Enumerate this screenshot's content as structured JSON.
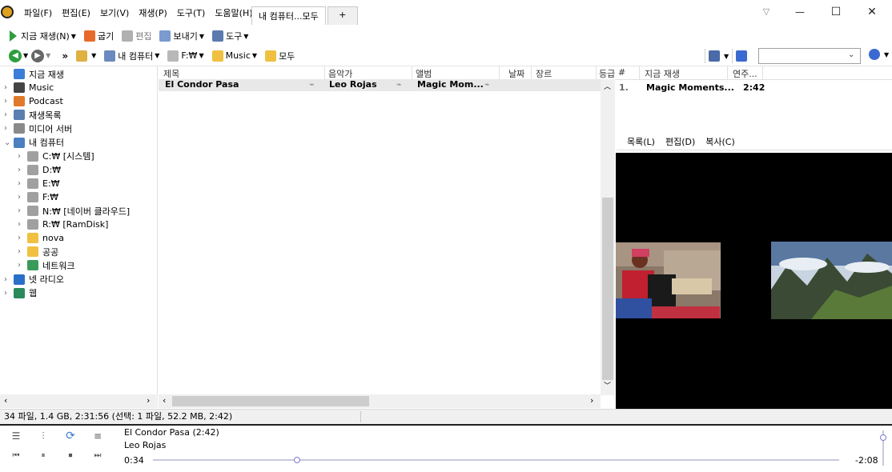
{
  "menu": [
    "파일(F)",
    "편집(E)",
    "보기(V)",
    "재생(P)",
    "도구(T)",
    "도움말(H)"
  ],
  "tabs": {
    "active": "내 컴퓨터...모두",
    "add": "+"
  },
  "window_controls": {
    "dropdown": "▽",
    "minimize": "—",
    "maximize": "☐",
    "close": "✕"
  },
  "toolbar1": {
    "play_now": "지금 재생(N)",
    "burn": "굽기",
    "edit": "편집",
    "send": "보내기",
    "tools": "도구"
  },
  "toolbar2": {
    "breadcrumbs": [
      "내 컴퓨터",
      "F:₩",
      "Music",
      "모두"
    ],
    "more": "»",
    "search_placeholder": ""
  },
  "tree": [
    {
      "label": "지금 재생",
      "level": 0,
      "arrow": "",
      "color": "#3b7dd8"
    },
    {
      "label": "Music",
      "level": 0,
      "arrow": "›",
      "color": "#444444"
    },
    {
      "label": "Podcast",
      "level": 0,
      "arrow": "›",
      "color": "#e07a2a"
    },
    {
      "label": "재생목록",
      "level": 0,
      "arrow": "›",
      "color": "#5a7fb0"
    },
    {
      "label": "미디어 서버",
      "level": 0,
      "arrow": "›",
      "color": "#8a8a8a"
    },
    {
      "label": "내 컴퓨터",
      "level": 0,
      "arrow": "⌄",
      "color": "#4a7fc0"
    },
    {
      "label": "C:₩ [시스템]",
      "level": 1,
      "arrow": "›",
      "color": "#a0a0a0"
    },
    {
      "label": "D:₩",
      "level": 1,
      "arrow": "›",
      "color": "#a0a0a0"
    },
    {
      "label": "E:₩",
      "level": 1,
      "arrow": "›",
      "color": "#a0a0a0"
    },
    {
      "label": "F:₩",
      "level": 1,
      "arrow": "›",
      "color": "#a0a0a0"
    },
    {
      "label": "N:₩ [네이버 클라우드]",
      "level": 1,
      "arrow": "›",
      "color": "#a0a0a0"
    },
    {
      "label": "R:₩ [RamDisk]",
      "level": 1,
      "arrow": "›",
      "color": "#a0a0a0"
    },
    {
      "label": "nova",
      "level": 1,
      "arrow": "›",
      "color": "#f0c040"
    },
    {
      "label": "공공",
      "level": 1,
      "arrow": "›",
      "color": "#f0c040"
    },
    {
      "label": "네트워크",
      "level": 1,
      "arrow": "›",
      "color": "#3a9a5a"
    },
    {
      "label": "넷 라디오",
      "level": 0,
      "arrow": "›",
      "color": "#2a6fc8"
    },
    {
      "label": "웹",
      "level": 0,
      "arrow": "›",
      "color": "#2a8a5a"
    }
  ],
  "list": {
    "columns": [
      "제목",
      "음악가",
      "앨범",
      "날짜",
      "장르",
      "등급"
    ],
    "rows": [
      {
        "title": "El Condor Pasa",
        "artist": "Leo Rojas",
        "album": "Magic Mom..."
      }
    ]
  },
  "now_playing": {
    "columns": [
      "#",
      "지금 재생",
      "연주..."
    ],
    "items": [
      {
        "num": "1.",
        "title": "Magic Moments...",
        "time": "2:42"
      }
    ],
    "menu": [
      "목록(L)",
      "편집(D)",
      "복사(C)"
    ]
  },
  "status": "34 파일, 1.4 GB, 2:31:56 (선택: 1 파일, 52.2 MB, 2:42)",
  "player": {
    "track": "El Condor Pasa (2:42)",
    "artist": "Leo Rojas",
    "elapsed": "0:34",
    "remaining": "-2:08",
    "progress_fraction": 0.21,
    "volume_fraction": 0.8
  },
  "colors": {
    "accent_green": "#2e9e3e",
    "folder_yellow": "#f0c040",
    "selection_gray": "#e8e8e8"
  }
}
